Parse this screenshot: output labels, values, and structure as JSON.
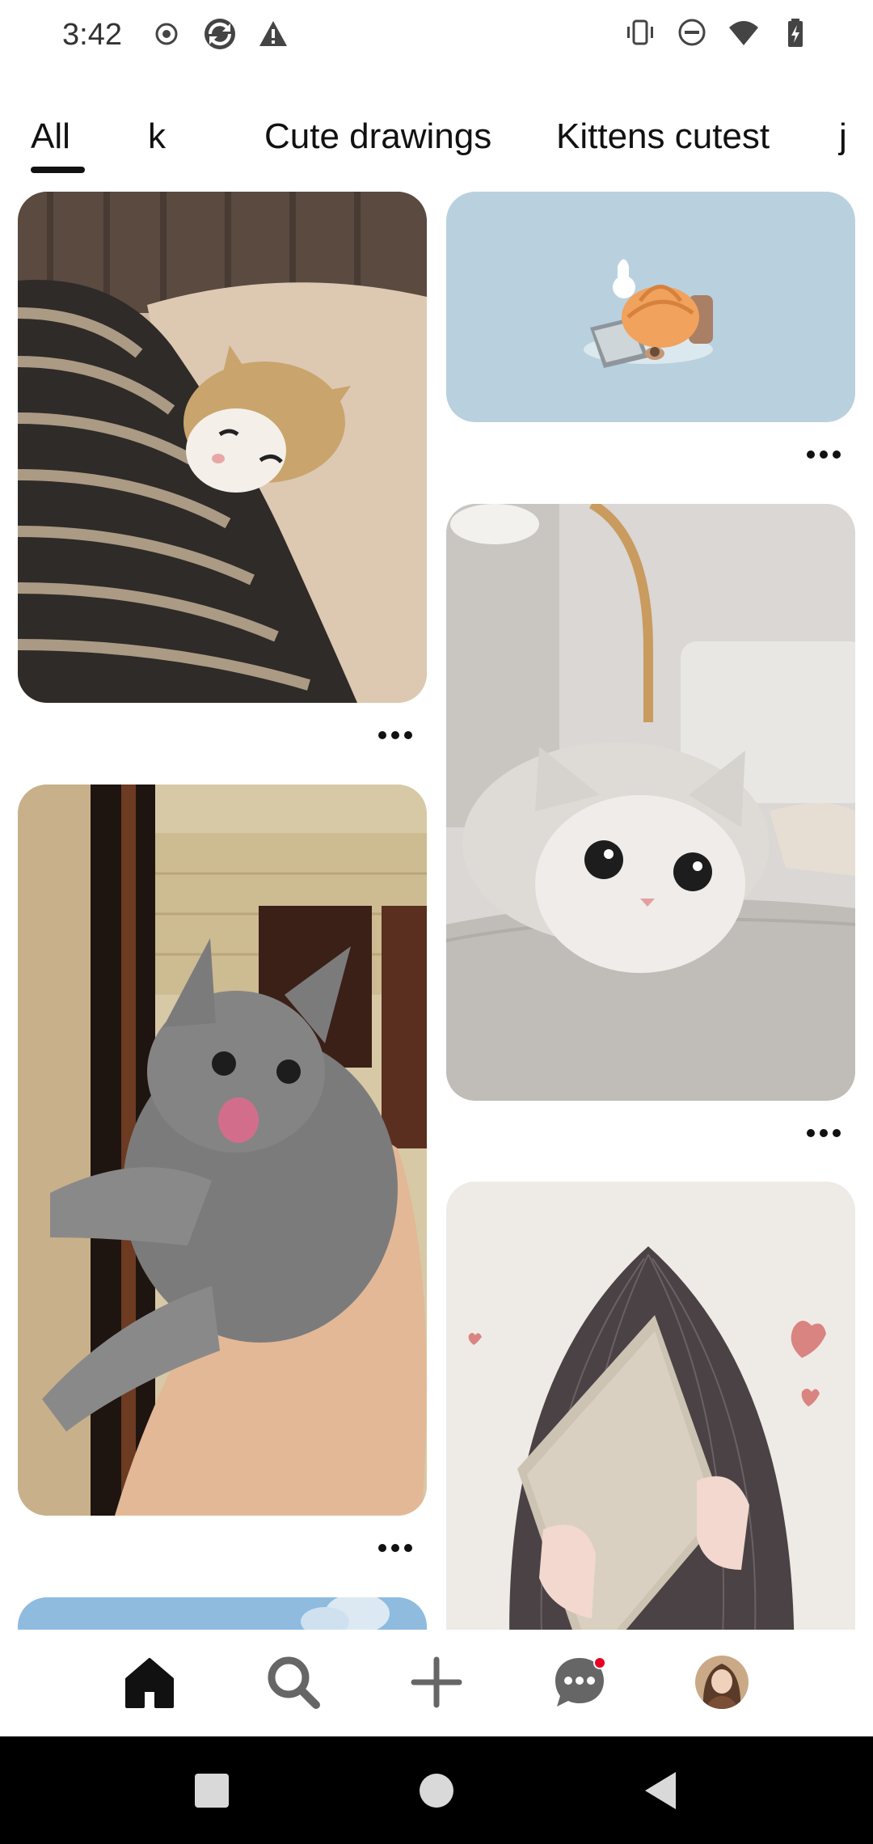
{
  "status_bar": {
    "time": "3:42",
    "left_icons": [
      "record-icon",
      "sync-icon",
      "warning-icon"
    ],
    "right_icons": [
      "vibrate-icon",
      "do-not-disturb-icon",
      "wifi-icon",
      "battery-icon"
    ]
  },
  "tabs": [
    {
      "label": "All",
      "selected": true
    },
    {
      "label": "k",
      "selected": false
    },
    {
      "label": "Cute drawings",
      "selected": false
    },
    {
      "label": "Kittens cutest",
      "selected": false
    },
    {
      "label": "j",
      "selected": false
    }
  ],
  "pins": [
    {
      "subject": "fluffy kitten sleeping on striped blanket"
    },
    {
      "subject": "illustrated orange cat on laptop"
    },
    {
      "subject": "white british shorthair cat on bed"
    },
    {
      "subject": "grey kitten held in hand licking lips"
    },
    {
      "subject": "illustrated girl holding book with hearts"
    },
    {
      "subject": "sky blue partial pin"
    }
  ],
  "bottom_nav": [
    {
      "name": "home-icon",
      "active": true
    },
    {
      "name": "search-icon",
      "active": false
    },
    {
      "name": "plus-icon",
      "active": false
    },
    {
      "name": "messages-icon",
      "active": false,
      "notification": true
    },
    {
      "name": "profile-avatar",
      "active": false
    }
  ],
  "colors": {
    "accent": "#e60023",
    "text": "#111111",
    "pin_blue": "#b9d1de",
    "system_nav": "#000000"
  }
}
